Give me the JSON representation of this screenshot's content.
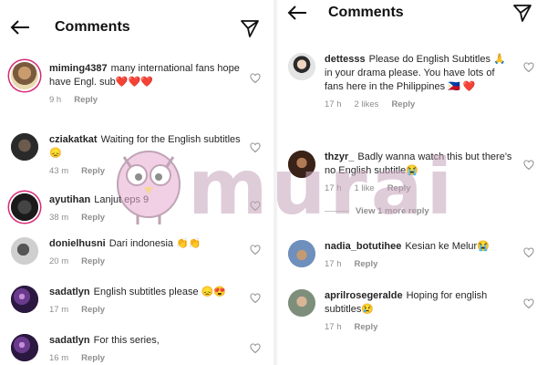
{
  "header": {
    "title": "Comments"
  },
  "watermark": {
    "text": "murai"
  },
  "left": {
    "comments": [
      {
        "username": "miming4387",
        "text": "many international fans hope have Engl. sub❤️❤️❤️",
        "time": "9 h",
        "reply": "Reply"
      },
      {
        "username": "cziakatkat",
        "text": "Waiting for the English subtitles 😞",
        "time": "43 m",
        "reply": "Reply"
      },
      {
        "username": "ayutihan",
        "text": "Lanjut eps 9",
        "time": "38 m",
        "reply": "Reply"
      },
      {
        "username": "donielhusni",
        "text": "Dari indonesia 👏👏",
        "time": "20 m",
        "reply": "Reply"
      },
      {
        "username": "sadatlyn",
        "text": "English subtitles please 😞😍",
        "time": "17 m",
        "reply": "Reply"
      },
      {
        "username": "sadatlyn",
        "text": "For this series,",
        "time": "16 m",
        "reply": "Reply"
      }
    ]
  },
  "right": {
    "comments": [
      {
        "username": "dettesss",
        "text": "Please do English Subtitles 🙏 in your drama please. You have lots of fans here in the Philippines 🇵🇭 ❤️",
        "time": "17 h",
        "likes": "2 likes",
        "reply": "Reply"
      },
      {
        "username": "thzyr_",
        "text": "Badly wanna watch this but there's no English subtitle😭",
        "time": "17 h",
        "likes": "1 like",
        "reply": "Reply"
      },
      {
        "username": "nadia_botutihee",
        "text": "Kesian ke Melur😭",
        "time": "17 h",
        "reply": "Reply"
      },
      {
        "username": "aprilrosegeralde",
        "text": "Hoping for english subtitles😢",
        "time": "17 h",
        "reply": "Reply"
      }
    ],
    "view_more": "View 1 more reply"
  },
  "colors": {
    "story_ring": "#d62976",
    "watermark": "#c6a3bb",
    "owl_body": "#e7a9cf"
  },
  "icons": [
    "back-arrow-icon",
    "send-icon",
    "heart-icon",
    "owl-mascot-icon"
  ]
}
